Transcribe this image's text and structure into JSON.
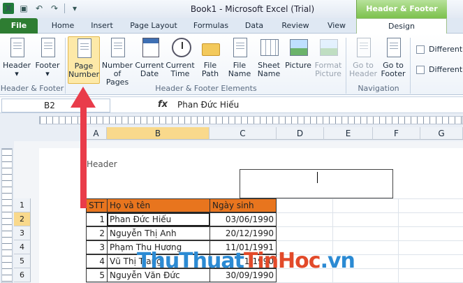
{
  "title": "Book1  -  Microsoft Excel (Trial)",
  "context_tab_group": "Header & Footer Tools",
  "tabs": [
    "File",
    "Home",
    "Insert",
    "Page Layout",
    "Formulas",
    "Data",
    "Review",
    "View",
    "Design"
  ],
  "ribbon": {
    "group1": {
      "label": "Header & Footer",
      "buttons": [
        "Header",
        "Footer"
      ]
    },
    "group2": {
      "label": "Header & Footer Elements",
      "buttons": [
        {
          "l1": "Page",
          "l2": "Number"
        },
        {
          "l1": "Number",
          "l2": "of Pages"
        },
        {
          "l1": "Current",
          "l2": "Date"
        },
        {
          "l1": "Current",
          "l2": "Time"
        },
        {
          "l1": "File",
          "l2": "Path"
        },
        {
          "l1": "File",
          "l2": "Name"
        },
        {
          "l1": "Sheet",
          "l2": "Name"
        },
        {
          "l1": "Picture",
          "l2": ""
        },
        {
          "l1": "Format",
          "l2": "Picture"
        }
      ]
    },
    "group3": {
      "label": "Navigation",
      "buttons": [
        {
          "l1": "Go to",
          "l2": "Header"
        },
        {
          "l1": "Go to",
          "l2": "Footer"
        }
      ]
    },
    "options": [
      "Different",
      "Different"
    ]
  },
  "formula_bar": {
    "name_box": "B2",
    "fx": "fx",
    "content": "Phan Đức Hiếu"
  },
  "columns": [
    "A",
    "B",
    "C",
    "D",
    "E",
    "F",
    "G"
  ],
  "rows": [
    "1",
    "2",
    "3",
    "4",
    "5",
    "6"
  ],
  "header_label": "Header",
  "table": {
    "headers": [
      "STT",
      "Họ và tên",
      "Ngày sinh"
    ],
    "rows": [
      {
        "stt": "1",
        "name": "Phan Đức Hiếu",
        "dob": "03/06/1990"
      },
      {
        "stt": "2",
        "name": "Nguyễn Thị Anh",
        "dob": "20/12/1990"
      },
      {
        "stt": "3",
        "name": "Phạm Thu Hương",
        "dob": "11/01/1991"
      },
      {
        "stt": "4",
        "name": "Vũ Thị Trang",
        "dob": "1/1990"
      },
      {
        "stt": "5",
        "name": "Nguyễn Văn Đức",
        "dob": "30/09/1990"
      }
    ]
  },
  "watermark": {
    "part1": "ThuThuat",
    "part2": "TinHoc",
    "part3": ".vn"
  },
  "colors": {
    "accent_green": "#2e7d32",
    "header_orange": "#e8751e",
    "arrow_red": "#e93c4a"
  }
}
